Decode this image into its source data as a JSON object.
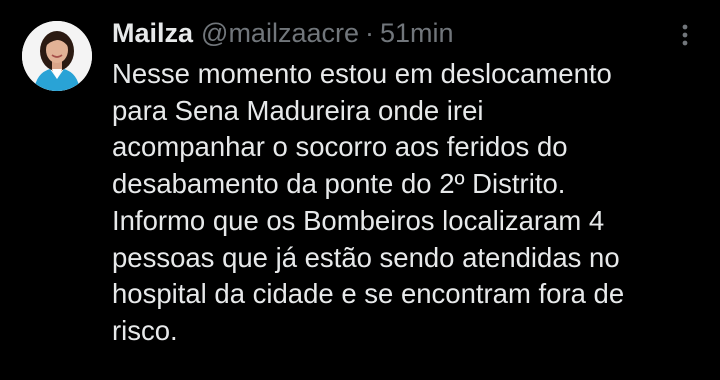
{
  "tweet": {
    "author": {
      "display_name": "Mailza",
      "handle": "@mailzaacre",
      "avatar_icon": "profile-photo",
      "separator": "·",
      "timestamp": "51min"
    },
    "more_icon": "more-vertical-icon",
    "text_lines": [
      "Nesse momento estou em deslocamento",
      "para Sena Madureira onde irei",
      "acompanhar o socorro aos feridos do",
      "desabamento da ponte do 2º Distrito.",
      "Informo que os Bombeiros localizaram 4",
      "pessoas que já estão sendo atendidas no",
      "hospital da cidade e se encontram fora de",
      "risco."
    ]
  },
  "colors": {
    "background": "#000000",
    "primary_text": "#e7e9ea",
    "secondary_text": "#71767b",
    "avatar_jacket": "#29a3d6",
    "avatar_hair": "#2b1a12"
  }
}
